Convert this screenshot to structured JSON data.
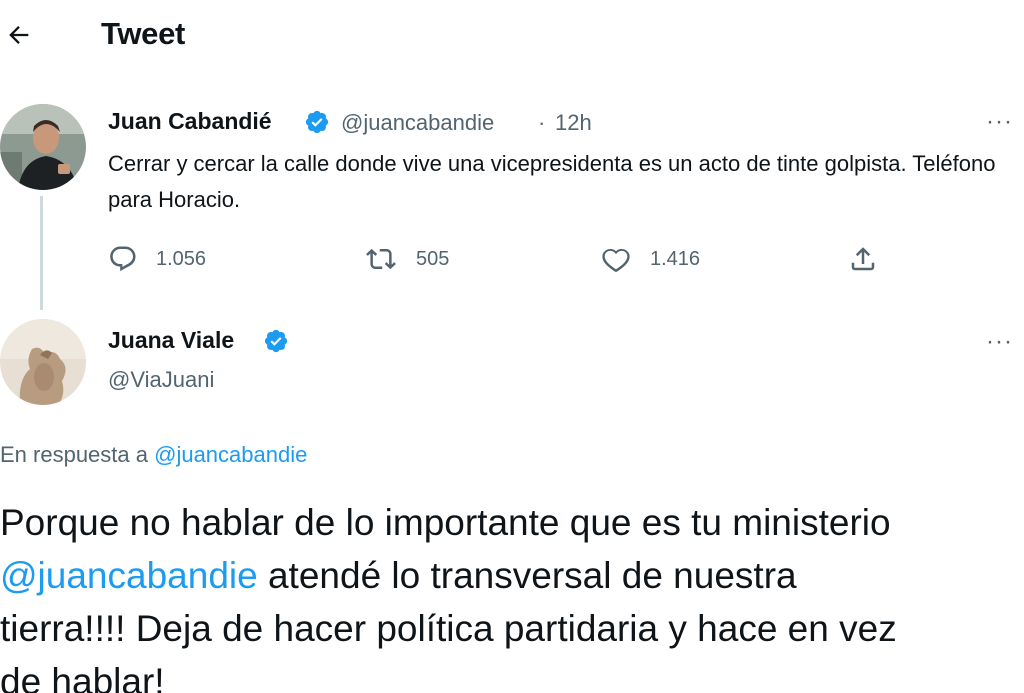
{
  "header": {
    "title": "Tweet",
    "back_icon": "arrow-left-icon"
  },
  "tweet1": {
    "name": "Juan Cabandié",
    "handle": "@juancabandie",
    "separator": "·",
    "time": "12h",
    "text": "Cerrar y cercar la calle donde vive una vicepresidenta es un acto de tinte golpista. Teléfono para Horacio.",
    "stats": {
      "replies": "1.056",
      "retweets": "505",
      "likes": "1.416"
    },
    "more_label": "···"
  },
  "tweet2": {
    "name": "Juana Viale",
    "handle": "@ViaJuani",
    "more_label": "···",
    "reply_prefix": "En respuesta a",
    "reply_mention": "@juancabandie",
    "text_line1": "Porque no hablar de lo importante que es tu ministerio",
    "text_mention": "@juancabandie",
    "text_rest": " atendé  lo transversal de nuestra\ntierra!!!! Deja de hacer política partidaria y hace en vez\nde hablar!"
  },
  "colors": {
    "accent": "#1d9bf0",
    "muted": "#536471",
    "text": "#0f1419",
    "thread_line": "#cfd9de"
  }
}
